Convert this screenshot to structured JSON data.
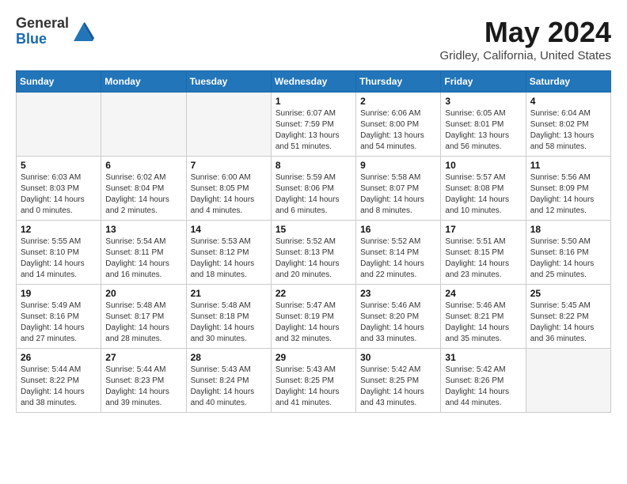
{
  "header": {
    "logo_general": "General",
    "logo_blue": "Blue",
    "month_title": "May 2024",
    "location": "Gridley, California, United States"
  },
  "days_of_week": [
    "Sunday",
    "Monday",
    "Tuesday",
    "Wednesday",
    "Thursday",
    "Friday",
    "Saturday"
  ],
  "weeks": [
    [
      {
        "day": "",
        "info": ""
      },
      {
        "day": "",
        "info": ""
      },
      {
        "day": "",
        "info": ""
      },
      {
        "day": "1",
        "info": "Sunrise: 6:07 AM\nSunset: 7:59 PM\nDaylight: 13 hours\nand 51 minutes."
      },
      {
        "day": "2",
        "info": "Sunrise: 6:06 AM\nSunset: 8:00 PM\nDaylight: 13 hours\nand 54 minutes."
      },
      {
        "day": "3",
        "info": "Sunrise: 6:05 AM\nSunset: 8:01 PM\nDaylight: 13 hours\nand 56 minutes."
      },
      {
        "day": "4",
        "info": "Sunrise: 6:04 AM\nSunset: 8:02 PM\nDaylight: 13 hours\nand 58 minutes."
      }
    ],
    [
      {
        "day": "5",
        "info": "Sunrise: 6:03 AM\nSunset: 8:03 PM\nDaylight: 14 hours\nand 0 minutes."
      },
      {
        "day": "6",
        "info": "Sunrise: 6:02 AM\nSunset: 8:04 PM\nDaylight: 14 hours\nand 2 minutes."
      },
      {
        "day": "7",
        "info": "Sunrise: 6:00 AM\nSunset: 8:05 PM\nDaylight: 14 hours\nand 4 minutes."
      },
      {
        "day": "8",
        "info": "Sunrise: 5:59 AM\nSunset: 8:06 PM\nDaylight: 14 hours\nand 6 minutes."
      },
      {
        "day": "9",
        "info": "Sunrise: 5:58 AM\nSunset: 8:07 PM\nDaylight: 14 hours\nand 8 minutes."
      },
      {
        "day": "10",
        "info": "Sunrise: 5:57 AM\nSunset: 8:08 PM\nDaylight: 14 hours\nand 10 minutes."
      },
      {
        "day": "11",
        "info": "Sunrise: 5:56 AM\nSunset: 8:09 PM\nDaylight: 14 hours\nand 12 minutes."
      }
    ],
    [
      {
        "day": "12",
        "info": "Sunrise: 5:55 AM\nSunset: 8:10 PM\nDaylight: 14 hours\nand 14 minutes."
      },
      {
        "day": "13",
        "info": "Sunrise: 5:54 AM\nSunset: 8:11 PM\nDaylight: 14 hours\nand 16 minutes."
      },
      {
        "day": "14",
        "info": "Sunrise: 5:53 AM\nSunset: 8:12 PM\nDaylight: 14 hours\nand 18 minutes."
      },
      {
        "day": "15",
        "info": "Sunrise: 5:52 AM\nSunset: 8:13 PM\nDaylight: 14 hours\nand 20 minutes."
      },
      {
        "day": "16",
        "info": "Sunrise: 5:52 AM\nSunset: 8:14 PM\nDaylight: 14 hours\nand 22 minutes."
      },
      {
        "day": "17",
        "info": "Sunrise: 5:51 AM\nSunset: 8:15 PM\nDaylight: 14 hours\nand 23 minutes."
      },
      {
        "day": "18",
        "info": "Sunrise: 5:50 AM\nSunset: 8:16 PM\nDaylight: 14 hours\nand 25 minutes."
      }
    ],
    [
      {
        "day": "19",
        "info": "Sunrise: 5:49 AM\nSunset: 8:16 PM\nDaylight: 14 hours\nand 27 minutes."
      },
      {
        "day": "20",
        "info": "Sunrise: 5:48 AM\nSunset: 8:17 PM\nDaylight: 14 hours\nand 28 minutes."
      },
      {
        "day": "21",
        "info": "Sunrise: 5:48 AM\nSunset: 8:18 PM\nDaylight: 14 hours\nand 30 minutes."
      },
      {
        "day": "22",
        "info": "Sunrise: 5:47 AM\nSunset: 8:19 PM\nDaylight: 14 hours\nand 32 minutes."
      },
      {
        "day": "23",
        "info": "Sunrise: 5:46 AM\nSunset: 8:20 PM\nDaylight: 14 hours\nand 33 minutes."
      },
      {
        "day": "24",
        "info": "Sunrise: 5:46 AM\nSunset: 8:21 PM\nDaylight: 14 hours\nand 35 minutes."
      },
      {
        "day": "25",
        "info": "Sunrise: 5:45 AM\nSunset: 8:22 PM\nDaylight: 14 hours\nand 36 minutes."
      }
    ],
    [
      {
        "day": "26",
        "info": "Sunrise: 5:44 AM\nSunset: 8:22 PM\nDaylight: 14 hours\nand 38 minutes."
      },
      {
        "day": "27",
        "info": "Sunrise: 5:44 AM\nSunset: 8:23 PM\nDaylight: 14 hours\nand 39 minutes."
      },
      {
        "day": "28",
        "info": "Sunrise: 5:43 AM\nSunset: 8:24 PM\nDaylight: 14 hours\nand 40 minutes."
      },
      {
        "day": "29",
        "info": "Sunrise: 5:43 AM\nSunset: 8:25 PM\nDaylight: 14 hours\nand 41 minutes."
      },
      {
        "day": "30",
        "info": "Sunrise: 5:42 AM\nSunset: 8:25 PM\nDaylight: 14 hours\nand 43 minutes."
      },
      {
        "day": "31",
        "info": "Sunrise: 5:42 AM\nSunset: 8:26 PM\nDaylight: 14 hours\nand 44 minutes."
      },
      {
        "day": "",
        "info": ""
      }
    ]
  ]
}
